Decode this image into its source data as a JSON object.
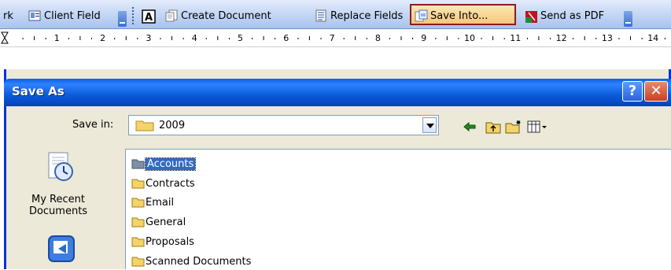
{
  "toolbar": {
    "items": [
      {
        "label": "rk",
        "icon": "truncated-item"
      },
      {
        "label": "Client Field",
        "icon": "client-field-icon"
      },
      {
        "label": "",
        "icon": "text-format-icon"
      },
      {
        "label": "Create Document",
        "icon": "create-document-icon"
      },
      {
        "label": "Replace Fields",
        "icon": "replace-fields-icon"
      },
      {
        "label": "Save Into...",
        "icon": "save-into-icon"
      },
      {
        "label": "Send as PDF",
        "icon": "pdf-icon"
      }
    ],
    "highlight_color": "#8a1e1e"
  },
  "ruler": {
    "numbers": [
      "1",
      "2",
      "3",
      "4",
      "5",
      "6",
      "7",
      "8",
      "9",
      "10",
      "11",
      "12",
      "13",
      "14"
    ]
  },
  "dialog": {
    "title": "Save As",
    "help_label": "?",
    "close_label": "✕",
    "save_in_label": "Save in:",
    "save_in_value": "2009",
    "places": [
      {
        "label": "My Recent Documents",
        "icon": "recent-documents-icon"
      },
      {
        "label": "",
        "icon": "desktop-icon"
      }
    ],
    "folders": [
      "Accounts",
      "Contracts",
      "Email",
      "General",
      "Proposals",
      "Scanned Documents"
    ],
    "selected_folder": "Accounts",
    "titlebar_color": "#0a5fe0",
    "selection_color": "#316ac5"
  }
}
